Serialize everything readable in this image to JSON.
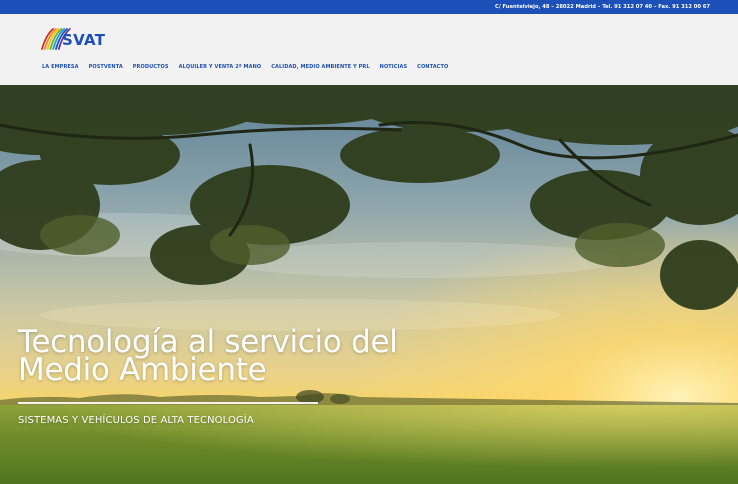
{
  "topbar": {
    "contact": "C/ Fuentelviejo, 48 – 28022 Madrid – Tel. 91 312 07 40 – Fax. 91 312 00 67"
  },
  "logo": {
    "text": "SVAT",
    "stripe_colors": [
      "#d92b2b",
      "#f08a1c",
      "#f5c400",
      "#5bb531",
      "#1d9bd9",
      "#1d4fb8",
      "#6a2fa0"
    ]
  },
  "nav": {
    "items": [
      "LA EMPRESA",
      "POSTVENTA",
      "PRODUCTOS",
      "ALQUILER Y VENTA 2ª MANO",
      "CALIDAD, MEDIO AMBIENTE Y PRL",
      "NOTICIAS",
      "CONTACTO"
    ]
  },
  "hero": {
    "title_line1": "Tecnología al servicio del",
    "title_line2": "Medio Ambiente",
    "subtitle": "SISTEMAS Y VEHÍCULOS DE ALTA TECNOLOGÍA"
  },
  "colors": {
    "brand_blue": "#1d4fb8",
    "header_bg": "#f2f2f2"
  }
}
